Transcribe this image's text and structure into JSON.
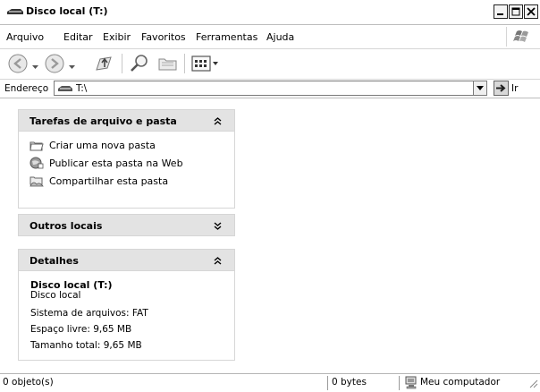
{
  "window": {
    "title": "Disco local (T:)"
  },
  "menu": {
    "items": [
      "Arquivo",
      "Editar",
      "Exibir",
      "Favoritos",
      "Ferramentas",
      "Ajuda"
    ]
  },
  "toolbar": {
    "icons": [
      "back-icon",
      "forward-icon",
      "up-folder-icon",
      "search-icon",
      "folders-icon",
      "views-icon"
    ]
  },
  "address": {
    "label": "Endereço",
    "value": "T:\\",
    "go_label": "Ir"
  },
  "tasks_panel": {
    "title": "Tarefas de arquivo e pasta",
    "items": [
      {
        "label": "Criar uma nova pasta",
        "icon": "new-folder-icon"
      },
      {
        "label": "Publicar esta pasta na Web",
        "icon": "publish-web-icon"
      },
      {
        "label": "Compartilhar esta pasta",
        "icon": "share-folder-icon"
      }
    ]
  },
  "other_places": {
    "title": "Outros locais"
  },
  "details": {
    "title": "Detalhes",
    "name": "Disco local (T:)",
    "type": "Disco local",
    "filesystem": "Sistema de arquivos: FAT",
    "free_space": "Espaço livre: 9,65 MB",
    "total_size": "Tamanho total: 9,65 MB"
  },
  "status": {
    "objects": "0 objeto(s)",
    "size": "0 bytes",
    "location": "Meu computador"
  }
}
